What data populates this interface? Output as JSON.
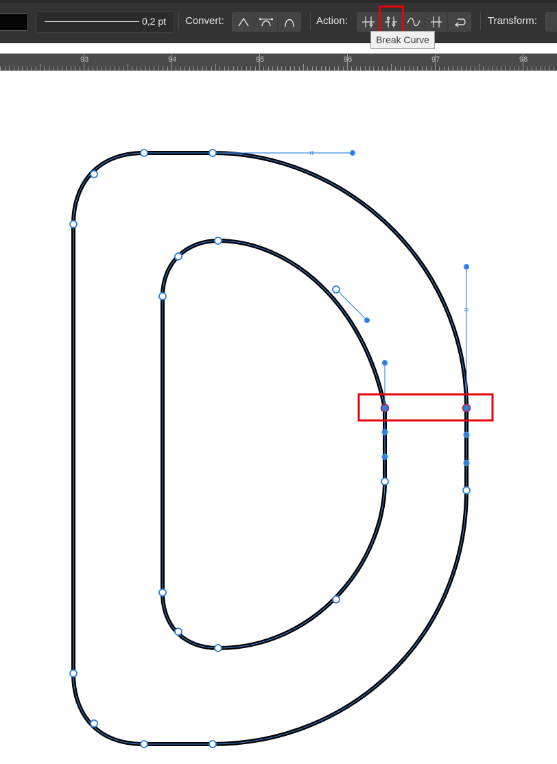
{
  "toolbar": {
    "stroke_width": "0,2 pt",
    "convert_label": "Convert:",
    "action_label": "Action:",
    "transform_label": "Transform:",
    "convert_buttons": [
      {
        "name": "convert-sharp-icon"
      },
      {
        "name": "convert-smooth-icon"
      },
      {
        "name": "convert-smart-icon"
      }
    ],
    "action_buttons": [
      {
        "name": "join-curves-icon"
      },
      {
        "name": "break-curve-icon"
      },
      {
        "name": "smooth-curve-icon"
      },
      {
        "name": "align-nodes-icon"
      },
      {
        "name": "reverse-curve-icon"
      }
    ]
  },
  "tooltip": {
    "text": "Break Curve"
  },
  "ruler": {
    "labels": [
      "93",
      "94",
      "95",
      "96",
      "97",
      "98"
    ]
  },
  "colors": {
    "toolbar_bg": "#333333",
    "ruler_bg": "#4a4a4a",
    "highlight": "#e8000b",
    "path_stroke": "#000000",
    "node_blue": "#2a7fe0"
  }
}
